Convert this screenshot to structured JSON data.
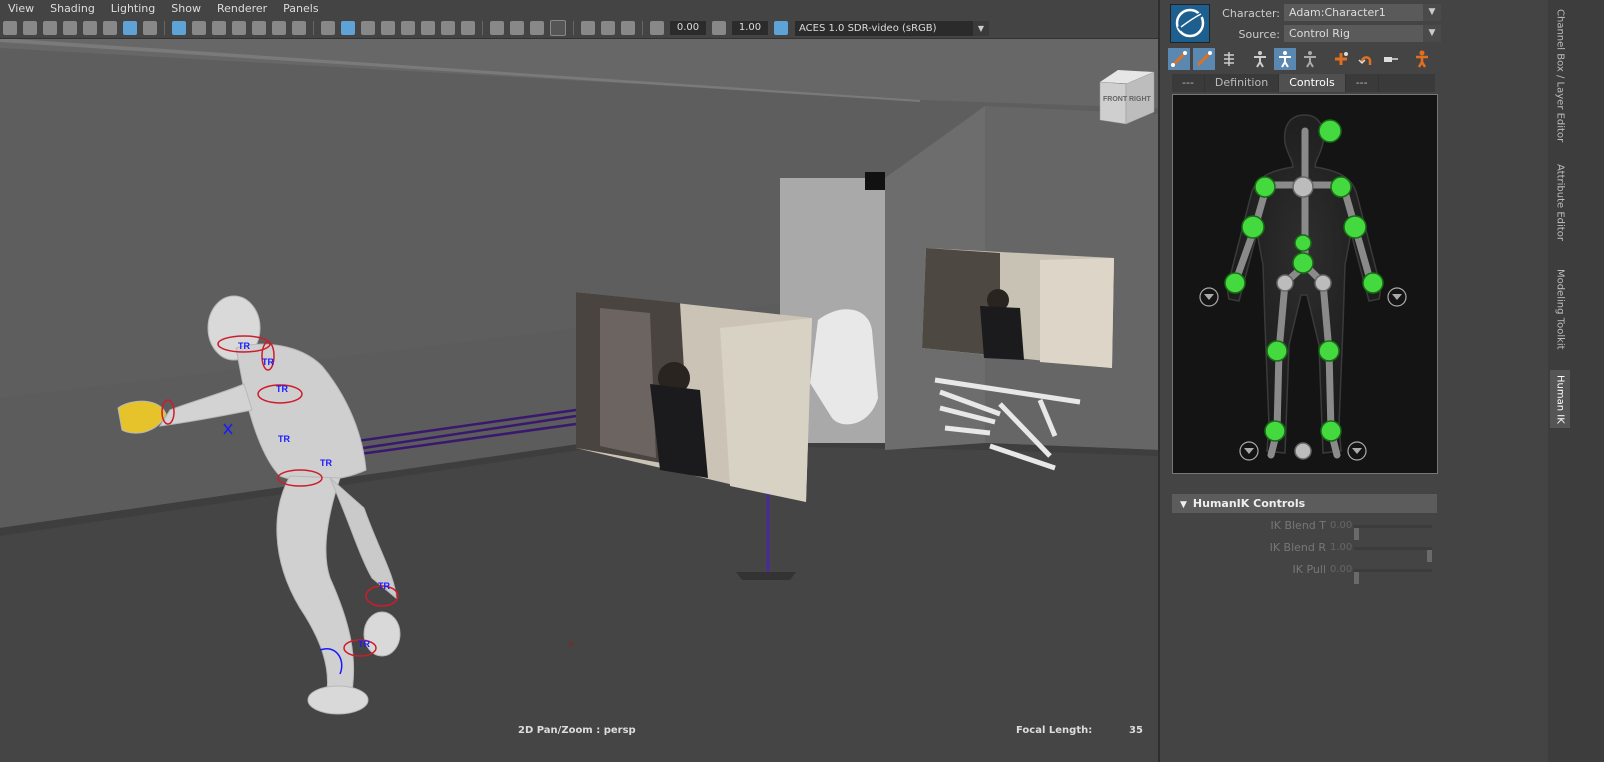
{
  "menu": [
    "View",
    "Shading",
    "Lighting",
    "Show",
    "Renderer",
    "Panels"
  ],
  "toolbar": {
    "exposure": "0.00",
    "gamma": "1.00",
    "color_space": "ACES 1.0 SDR-video (sRGB)"
  },
  "viewcube": {
    "front": "FRONT",
    "right": "RIGHT"
  },
  "hud": {
    "pan_zoom": "2D Pan/Zoom : persp",
    "focal_label": "Focal Length:",
    "focal_value": "35"
  },
  "rig_labels": {
    "tr": "TR"
  },
  "hik": {
    "character_label": "Character:",
    "character_value": "Adam:Character1",
    "source_label": "Source:",
    "source_value": "Control Rig",
    "tabs": [
      {
        "label": "---",
        "active": false
      },
      {
        "label": "Definition",
        "active": false
      },
      {
        "label": "Controls",
        "active": true
      },
      {
        "label": "---",
        "active": false
      }
    ],
    "section_title": "HumanIK Controls",
    "sliders": [
      {
        "label": "IK Blend T",
        "value": "0.00",
        "level": 0
      },
      {
        "label": "IK Blend R",
        "value": "1.00",
        "level": 1
      },
      {
        "label": "IK Pull",
        "value": "0.00",
        "level": 0
      }
    ]
  },
  "side_tabs": [
    {
      "label": "Channel Box / Layer Editor",
      "active": false
    },
    {
      "label": "Attribute Editor",
      "active": false
    },
    {
      "label": "Modeling Toolkit",
      "active": false
    },
    {
      "label": "Human IK",
      "active": true
    }
  ],
  "colors": {
    "viewport_bg": "#5c5c5c",
    "floor": "#454545",
    "active_blue": "#5fa3d6",
    "green_effector": "#44d93e",
    "rig_blue": "#1a1aff",
    "rig_red": "#cc1d2a",
    "purple_line": "#3a1870"
  }
}
